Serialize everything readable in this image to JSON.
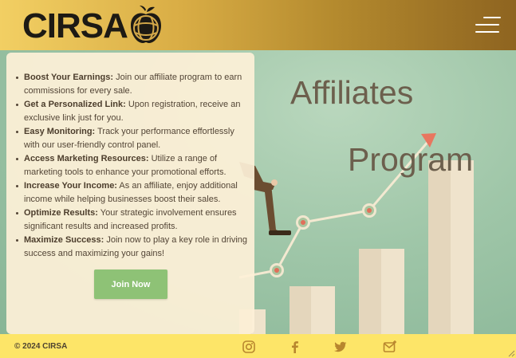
{
  "header": {
    "logo_text": "CIRSA",
    "menu_icon": "hamburger-menu-icon",
    "colors": {
      "gradient_start": "#f2cf63",
      "gradient_end": "#8e6420",
      "logo": "#1d1a14"
    }
  },
  "hero": {
    "title_line1": "Affiliates",
    "title_line2": "Program",
    "illustration": "growth-chart-stairs-illustration"
  },
  "benefits": [
    {
      "title": "Boost Your Earnings:",
      "text": " Join our affiliate program to earn commissions for every sale."
    },
    {
      "title": "Get a Personalized Link:",
      "text": " Upon registration, receive an exclusive link just for you."
    },
    {
      "title": "Easy Monitoring:",
      "text": " Track your performance effortlessly with our user-friendly control panel."
    },
    {
      "title": "Access Marketing Resources:",
      "text": " Utilize a range of marketing tools to enhance your promotional efforts."
    },
    {
      "title": "Increase Your Income:",
      "text": " As an affiliate, enjoy additional income while helping businesses boost their sales."
    },
    {
      "title": "Optimize Results:",
      "text": " Your strategic involvement ensures significant results and increased profits."
    },
    {
      "title": "Maximize Success:",
      "text": " Join now to play a key role in driving success and maximizing your gains!"
    }
  ],
  "cta": {
    "label": "Join Now",
    "color": "#8ec276"
  },
  "footer": {
    "copyright": "© 2024 CIRSA",
    "social_icons": [
      "instagram-icon",
      "facebook-icon",
      "twitter-icon",
      "email-icon"
    ],
    "background": "#fde568"
  }
}
